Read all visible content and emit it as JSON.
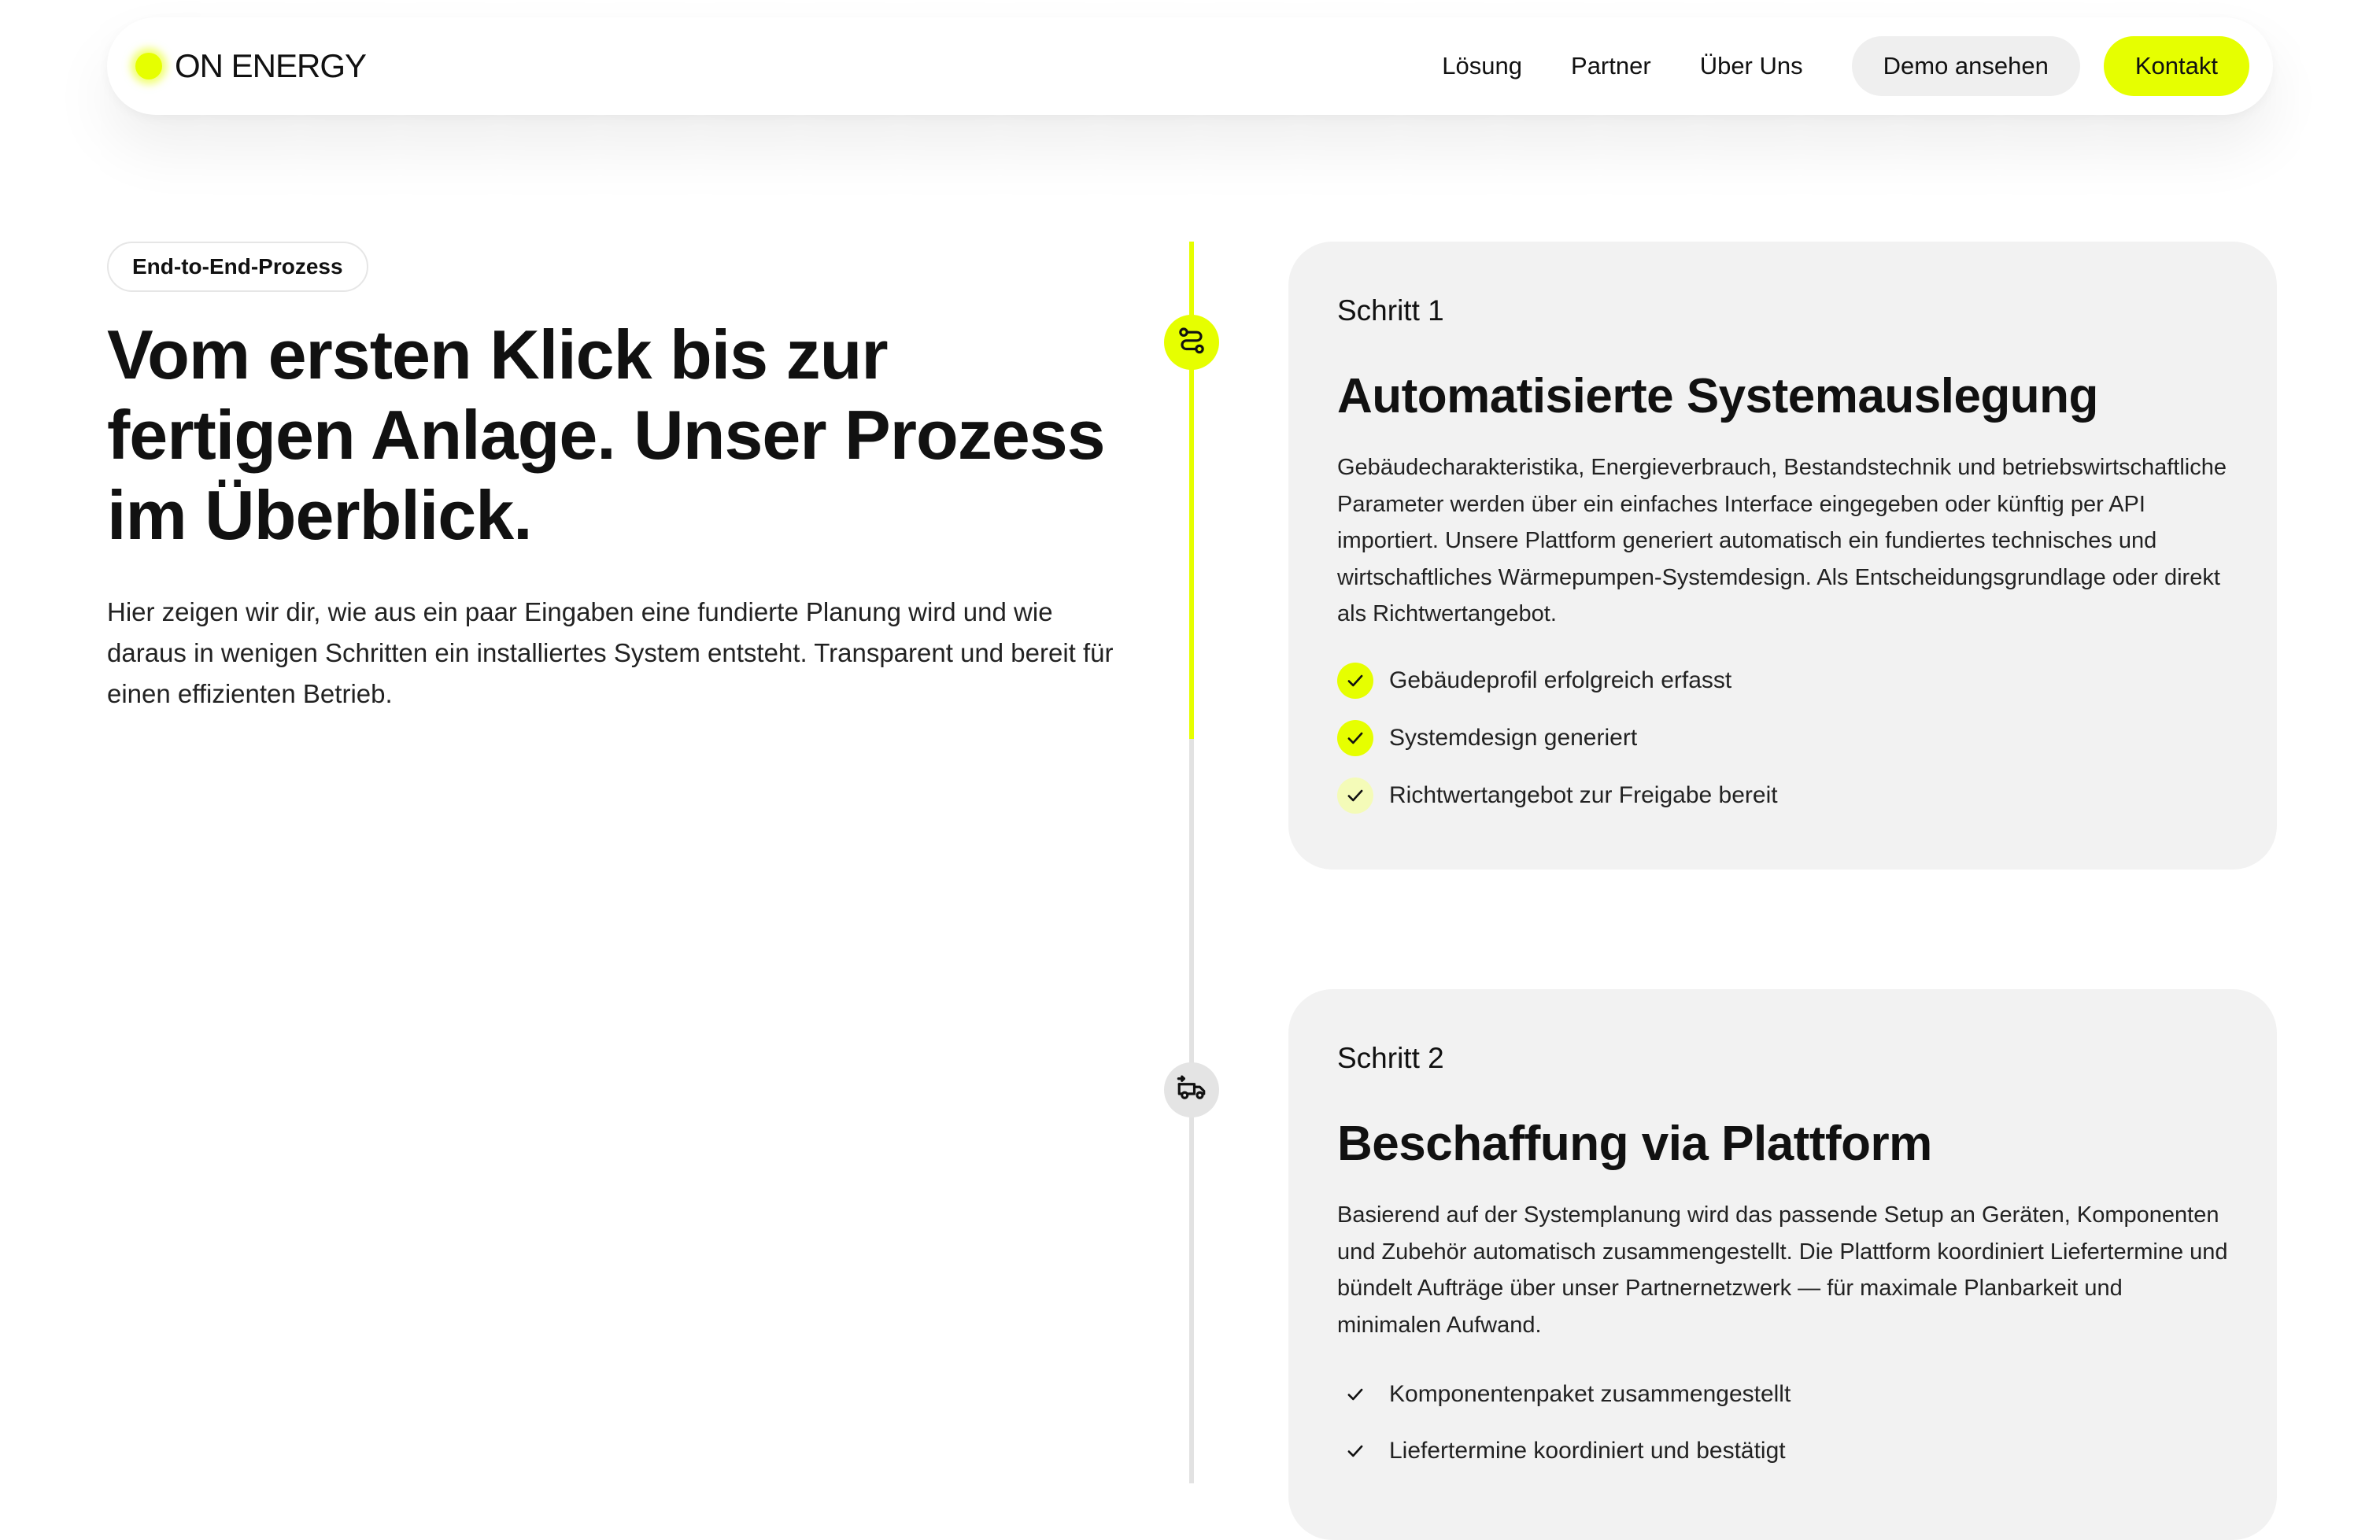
{
  "nav": {
    "brand": "ON ENERGY",
    "links": [
      "Lösung",
      "Partner",
      "Über Uns"
    ],
    "demo_label": "Demo ansehen",
    "contact_label": "Kontakt"
  },
  "hero": {
    "tag": "End-to-End-Prozess",
    "headline": "Vom ersten Klick bis zur fertigen Anlage. Unser Prozess im Überblick.",
    "intro": "Hier zeigen wir dir, wie aus ein paar Eingaben eine fundierte Planung wird und wie daraus in wenigen Schritten ein installiertes System entsteht. Transparent und bereit für einen effizienten Betrieb."
  },
  "timeline": {
    "accent_color": "#e6ff00",
    "track_color": "#e2e2e2",
    "nodes": [
      {
        "icon": "route-icon",
        "active": true
      },
      {
        "icon": "delivery-truck-icon",
        "active": false
      }
    ]
  },
  "steps": [
    {
      "label": "Schritt 1",
      "title": "Automatisierte Systemauslegung",
      "description": "Gebäudecharakteristika, Energieverbrauch, Bestandstechnik und betriebswirtschaftliche Parameter werden über ein einfaches Interface eingegeben oder künftig per API importiert. Unsere Plattform generiert automatisch ein fundiertes technisches und wirtschaftliches Wärmepumpen-Systemdesign. Als Entscheidungsgrundlage oder direkt als Richtwertangebot.",
      "checks": [
        {
          "text": "Gebäudeprofil erfolgreich erfasst",
          "state": "full"
        },
        {
          "text": "Systemdesign generiert",
          "state": "full"
        },
        {
          "text": "Richtwertangebot zur Freigabe bereit",
          "state": "soft"
        }
      ]
    },
    {
      "label": "Schritt 2",
      "title": "Beschaffung via Plattform",
      "description": "Basierend auf der Systemplanung wird das passende Setup an Geräten, Komponenten und Zubehör automatisch zusammengestellt. Die Plattform koordiniert Liefertermine und bündelt Aufträge über unser Partnernetzwerk — für maximale Planbarkeit und minimalen Aufwand.",
      "checks": [
        {
          "text": "Komponentenpaket zusammengestellt",
          "state": "none"
        },
        {
          "text": "Liefertermine koordiniert und bestätigt",
          "state": "none"
        }
      ]
    }
  ]
}
